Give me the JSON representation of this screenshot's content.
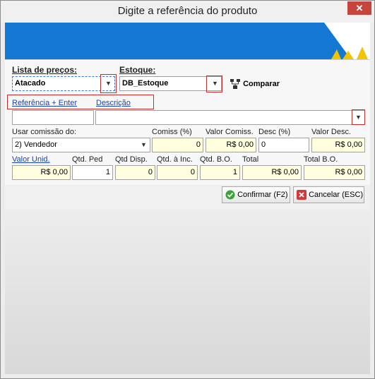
{
  "window": {
    "title": "Digite a referência do produto",
    "close_glyph": "✕"
  },
  "price_list": {
    "label": "Lista de preços:",
    "value": "Atacado"
  },
  "stock": {
    "label": "Estoque:",
    "value": "DB_Estoque"
  },
  "compare": {
    "label": "Comparar",
    "icon": "compare-icon"
  },
  "search": {
    "ref_link": "Referência + Enter",
    "desc_link": "Descrição",
    "ref_value": "",
    "desc_value": ""
  },
  "commission": {
    "label": "Usar comissão do:",
    "value": "2) Vendedor"
  },
  "comiss_pct": {
    "label": "Comiss (%)",
    "value": "0"
  },
  "valor_comiss": {
    "label": "Valor Comiss.",
    "value": "R$ 0,00"
  },
  "desc_pct": {
    "label": "Desc (%)",
    "value": "0"
  },
  "valor_desc": {
    "label": "Valor Desc.",
    "value": "R$ 0,00"
  },
  "valor_unid": {
    "label": "Valor Unid.",
    "value": "R$ 0,00"
  },
  "qtd_ped": {
    "label": "Qtd. Ped",
    "value": "1"
  },
  "qtd_disp": {
    "label": "Qtd Disp.",
    "value": "0"
  },
  "qtd_inc": {
    "label": "Qtd. à Inc.",
    "value": "0"
  },
  "qtd_bo": {
    "label": "Qtd. B.O.",
    "value": "1"
  },
  "total": {
    "label": "Total",
    "value": "R$ 0,00"
  },
  "total_bo": {
    "label": "Total B.O.",
    "value": "R$ 0,00"
  },
  "buttons": {
    "confirm": "Confirmar (F2)",
    "cancel": "Cancelar (ESC)"
  },
  "colors": {
    "banner": "#1478d2",
    "highlight_red": "#cc2a2a",
    "link": "#1a44b6",
    "readonly_field": "#ffffe0"
  }
}
